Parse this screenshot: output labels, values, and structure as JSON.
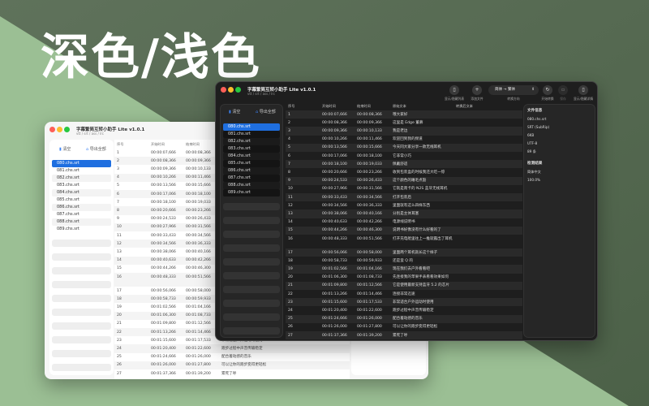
{
  "hero_title": "深色/浅色",
  "colors": {
    "bg_light": "#9bbf94",
    "bg_dark": "#5a6c57",
    "accent": "#1f6fe0"
  },
  "app": {
    "title": "字幕繁简互转小助手 Lite v1.0.1",
    "subtitle": "vtt / srt / ass / lrc"
  },
  "sidebar": {
    "clear_label": "清空",
    "export_label": "导出全部",
    "files": [
      "080.chs.srt",
      "081.chs.srt",
      "082.chs.srt",
      "083.chs.srt",
      "084.chs.srt",
      "085.chs.srt",
      "086.chs.srt",
      "087.chs.srt",
      "088.chs.srt",
      "089.chs.srt"
    ]
  },
  "toolbar": {
    "toggle_list": "显示/隐藏列表",
    "add_file": "添加文件",
    "direction_value": "简体 → 繁体",
    "direction_label": "转换方向",
    "convert": "开始转换",
    "save": "保存",
    "toggle_detail": "显示/隐藏详情"
  },
  "table": {
    "headers": [
      "序号",
      "开始时间",
      "结束时间",
      "原始文本",
      "转换后文本"
    ],
    "rows": [
      [
        "1",
        "00:00:07,666",
        "00:00:08,366",
        "哦大家好"
      ],
      [
        "2",
        "00:00:08,366",
        "00:00:09,366",
        "这里是 Edge 董慕"
      ],
      [
        "3",
        "00:00:09,366",
        "00:00:10,133",
        "我是老边"
      ],
      [
        "4",
        "00:00:10,266",
        "00:00:11,466",
        "欢迎回到我的频道"
      ],
      [
        "5",
        "00:00:13,566",
        "00:00:15,666",
        "今天同大家分享一款无线耳机"
      ],
      [
        "6",
        "00:00:17,066",
        "00:00:18,100",
        "它非常小巧"
      ],
      [
        "7",
        "00:00:18,100",
        "00:00:19,033",
        "佩戴舒适"
      ],
      [
        "8",
        "00:00:20,666",
        "00:00:23,266",
        "收到包装盒的时候我还大吃一惊"
      ],
      [
        "9",
        "00:00:24,533",
        "00:00:26,433",
        "这个颜色的睡毛点豁"
      ],
      [
        "10",
        "00:00:27,966",
        "00:00:31,566",
        "它就是南卡的 N2S 蓝牙无线耳机"
      ],
      [
        "11",
        "00:00:33,433",
        "00:00:34,566",
        "打开包装后"
      ],
      [
        "12",
        "00:00:34,566",
        "00:00:36,333",
        "里面就有这么四样东西"
      ],
      [
        "13",
        "00:00:38,066",
        "00:00:40,166",
        "分别是主体耳塞"
      ],
      [
        "14",
        "00:00:40,633",
        "00:00:42,266",
        "电源线说明书"
      ],
      [
        "15",
        "00:00:44,266",
        "00:00:46,300",
        "说明书好像没有什么好看的了"
      ],
      [
        "16",
        "00:00:48,333",
        "00:00:51,566",
        "打开充电舱里往上一推就露出了耳机"
      ],
      [
        "17",
        "00:00:56,066",
        "00:00:58,000",
        "里面两个耳机就长这个样子"
      ],
      [
        "18",
        "00:00:58,733",
        "00:00:59,933",
        "还是蛮 Q 的"
      ],
      [
        "19",
        "00:01:02,566",
        "00:01:04,166",
        "现在我们去户外看看吧"
      ],
      [
        "20",
        "00:01:06,300",
        "00:01:08,733",
        "先连接我的苹果手表看看效果如何"
      ],
      [
        "21",
        "00:01:09,800",
        "00:01:12,566",
        "它是使用最新支持蓝牙 5.2 的芯片"
      ],
      [
        "22",
        "00:01:13,266",
        "00:01:14,466",
        "连接非常迅速"
      ],
      [
        "23",
        "00:01:15,600",
        "00:01:17,533",
        "非常适合户外运动时使用"
      ],
      [
        "24",
        "00:01:20,400",
        "00:01:22,600",
        "跑步过程中声音传输稳定"
      ],
      [
        "25",
        "00:01:24,666",
        "00:01:26,000",
        "配合着动感的音乐"
      ],
      [
        "26",
        "00:01:26,000",
        "00:01:27,800",
        "可以让你的跑步变得更轻松"
      ],
      [
        "27",
        "00:01:37,366",
        "00:01:39,200",
        "累死了呼"
      ]
    ]
  },
  "detail": {
    "file_info_title": "文件信息",
    "file_name": "080.chs.srt",
    "format": "SRT (SubRip)",
    "size": "6KB",
    "encoding": "UTF-8",
    "count": "89 条",
    "detect_title": "检测结果",
    "language": "简体中文",
    "confidence": "100.0%"
  }
}
